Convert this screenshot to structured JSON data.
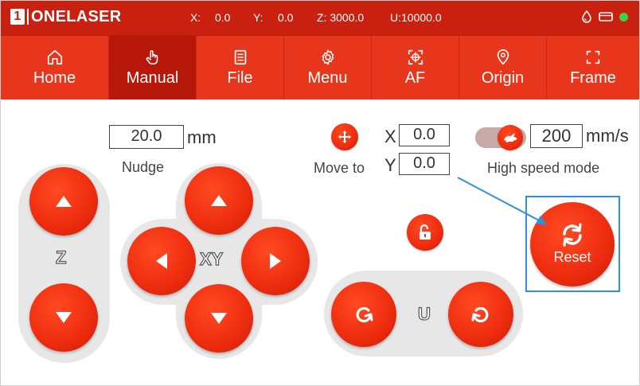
{
  "header": {
    "logo_mark": "1",
    "logo_text": "ONELASER",
    "x_label": "X:",
    "x_value": "0.0",
    "y_label": "Y:",
    "y_value": "0.0",
    "z": "Z: 3000.0",
    "u": "U:10000.0",
    "status_icons": [
      "water-drop-icon",
      "card-icon",
      "connection-dot-icon"
    ],
    "status_color": "#3fd14a"
  },
  "nav": {
    "items": [
      {
        "label": "Home",
        "icon": "home-icon"
      },
      {
        "label": "Manual",
        "icon": "hand-pointer-icon",
        "active": true
      },
      {
        "label": "File",
        "icon": "file-list-icon"
      },
      {
        "label": "Menu",
        "icon": "gear-icon"
      },
      {
        "label": "AF",
        "icon": "autofocus-crosshair-icon"
      },
      {
        "label": "Origin",
        "icon": "location-pin-icon"
      },
      {
        "label": "Frame",
        "icon": "frame-corners-icon"
      }
    ]
  },
  "manual": {
    "nudge_value": "20.0",
    "nudge_unit": "mm",
    "nudge_label": "Nudge",
    "z_pad_label": "Z",
    "xy_pad_label": "XY",
    "u_pad_label": "U",
    "move_to_label": "Move to",
    "move_x_label": "X",
    "move_x_value": "0.0",
    "move_y_label": "Y",
    "move_y_value": "0.0",
    "speed_value": "200",
    "speed_unit": "mm/s",
    "high_speed_label": "High speed mode",
    "high_speed_on": true,
    "reset_label": "Reset"
  },
  "colors": {
    "accent": "#e8361c",
    "top_bar": "#c9200f",
    "button": "#ef2e10",
    "highlight": "#2f8fe3",
    "pad_bg": "#e7e7e7"
  }
}
